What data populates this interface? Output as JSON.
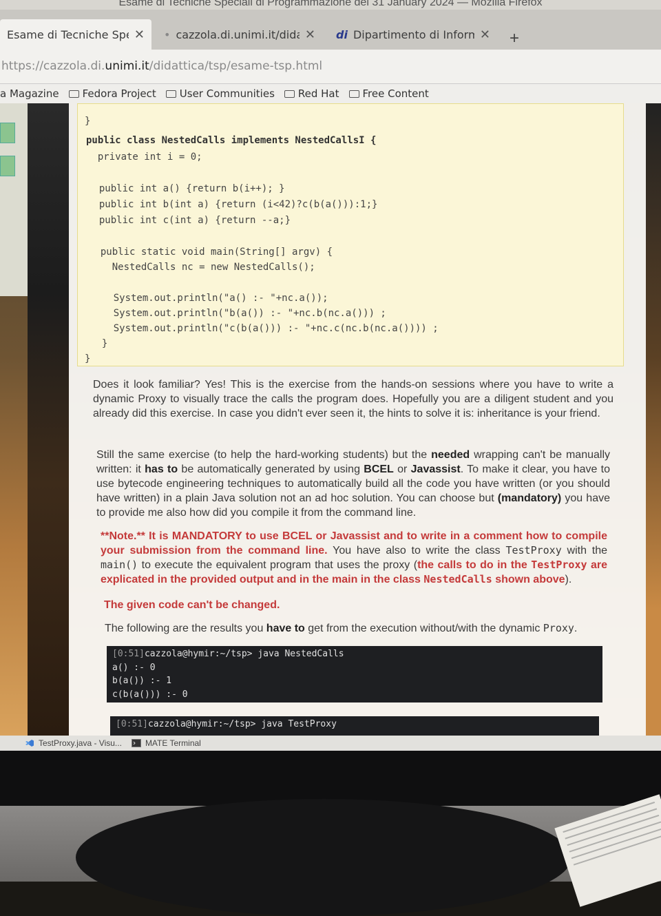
{
  "window_title": "Esame di Tecniche Speciali di Programmazione del 31 January 2024 — Mozilla Firefox",
  "tabs": [
    {
      "label": "Esame di Tecniche Special",
      "active": true
    },
    {
      "label": "cazzola.di.unimi.it/didattic",
      "active": false
    },
    {
      "label": "Dipartimento di Informati",
      "active": false
    }
  ],
  "new_tab_label": "+",
  "url": {
    "prefix": "https://cazzola.di.",
    "domain": "unimi.it",
    "path": "/didattica/tsp/esame-tsp.html"
  },
  "bookmarks": [
    "a Magazine",
    "Fedora Project",
    "User Communities",
    "Red Hat",
    "Free Content"
  ],
  "code_lines": [
    "}",
    "public class NestedCalls implements NestedCallsI {",
    "  private int i = 0;",
    "",
    "  public int a() {return b(i++); }",
    "  public int b(int a) {return (i<42)?c(b(a())):1;}",
    "  public int c(int a) {return --a;}",
    "",
    "  public static void main(String[] argv) {",
    "    NestedCalls nc = new NestedCalls();",
    "",
    "    System.out.println(\"a() :- \"+nc.a());",
    "    System.out.println(\"b(a()) :- \"+nc.b(nc.a())) ;",
    "    System.out.println(\"c(b(a())) :- \"+nc.c(nc.b(nc.a()))) ;",
    "  }",
    "}"
  ],
  "para1": "Does it look familiar? Yes! This is the exercise from the hands-on sessions where you have to write a dynamic Proxy to visually trace the calls the program does. Hopefully you are a diligent student and you already did this exercise. In case you didn't ever seen it, the hints to solve it is: inheritance is your friend.",
  "para2": {
    "t1": "Still the same exercise (to help the hard-working students) but the ",
    "b1": "needed",
    "t2": " wrapping can't be manually written: it ",
    "b2": "has to",
    "t3": " be automatically generated by using ",
    "b3": "BCEL",
    "t4": " or ",
    "b4": "Javassist",
    "t5": ". To make it clear, you have to use bytecode engineering techniques to automatically build all the code you have written (or you should have written) in a plain Java solution not an ad hoc solution. You can choose but ",
    "b5": "(mandatory)",
    "t6": " you have to provide me also how did you compile it from the command line."
  },
  "para3": {
    "r1": "**Note.** It is MANDATORY to use BCEL or Javassist and to write in a comment how to compile your submission from the command line.",
    "t1": " You have also to write the class ",
    "m1": "TestProxy",
    "t2": " with the ",
    "m2": "main()",
    "t3": " to execute the equivalent program that uses the proxy (",
    "r2": "the calls to do in the ",
    "rm1": "TestProxy",
    "r3": " are explicated in the provided output and in the main in the class ",
    "rm2": "NestedCalls",
    "r4": " shown above",
    "t4": ")."
  },
  "para4": "The given code can't be changed.",
  "para5": {
    "t1": "The following are the results you ",
    "b1": "have to",
    "t2": " get from the execution without/with the dynamic ",
    "m1": "Proxy",
    "t3": "."
  },
  "terminal1": {
    "time": "[0:51]",
    "prompt": "cazzola@hymir:~/tsp> java NestedCalls",
    "lines": [
      "a() :- 0",
      "b(a()) :- 1",
      "c(b(a())) :- 0"
    ]
  },
  "terminal2": {
    "time": "[0:51]",
    "prompt": "cazzola@hymir:~/tsp> java TestProxy"
  },
  "taskbar": [
    "TestProxy.java - Visu...",
    "MATE Terminal"
  ]
}
